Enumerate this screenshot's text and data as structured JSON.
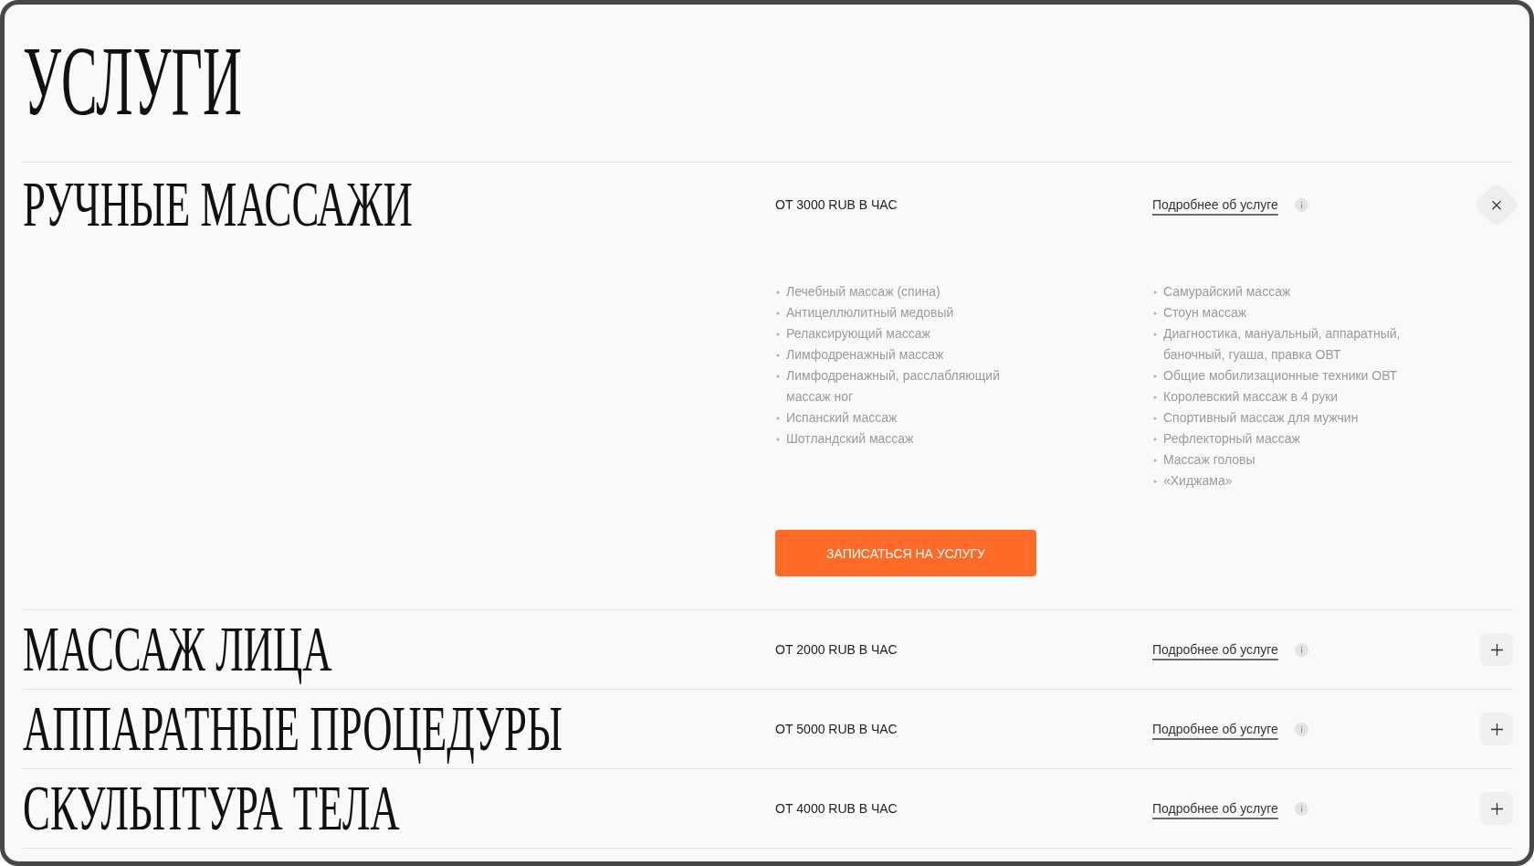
{
  "page": {
    "title": "УСЛУГИ"
  },
  "services": [
    {
      "name": "РУЧНЫЕ МАССАЖИ",
      "price": "ОТ 3000 RUB В ЧАС",
      "details_link": "Подробнее об услуге",
      "expanded": true,
      "details": {
        "columns": [
          {
            "items": [
              "Лечебный массаж (спина)",
              "Антицеллюлитный медовый",
              "Релаксирующий массаж",
              "Лимфодренажный массаж",
              "Лимфодренажный, расслабляющий массаж ног",
              "Испанский массаж",
              "Шотландский массаж"
            ]
          },
          {
            "items": [
              "Самурайский массаж",
              "Стоун массаж",
              "Диагностика, мануальный, аппаратный, баночный, гуаша, правка ОВТ",
              "Общие мобилизационные техники ОВТ",
              "Королевский массаж в 4 руки",
              "Спортивный массаж для мужчин",
              "Рефлекторный массаж",
              "Массаж головы",
              "«Хиджама»"
            ]
          }
        ],
        "book_button": "ЗАПИСАТЬСЯ НА УСЛУГУ"
      }
    },
    {
      "name": "МАССАЖ ЛИЦА",
      "price": "ОТ 2000 RUB В ЧАС",
      "details_link": "Подробнее об услуге",
      "expanded": false
    },
    {
      "name": "АППАРАТНЫЕ ПРОЦЕДУРЫ",
      "price": "ОТ 5000 RUB В ЧАС",
      "details_link": "Подробнее об услуге",
      "expanded": false
    },
    {
      "name": "СКУЛЬПТУРА ТЕЛА",
      "price": "ОТ 4000 RUB В ЧАС",
      "details_link": "Подробнее об услуге",
      "expanded": false
    }
  ]
}
